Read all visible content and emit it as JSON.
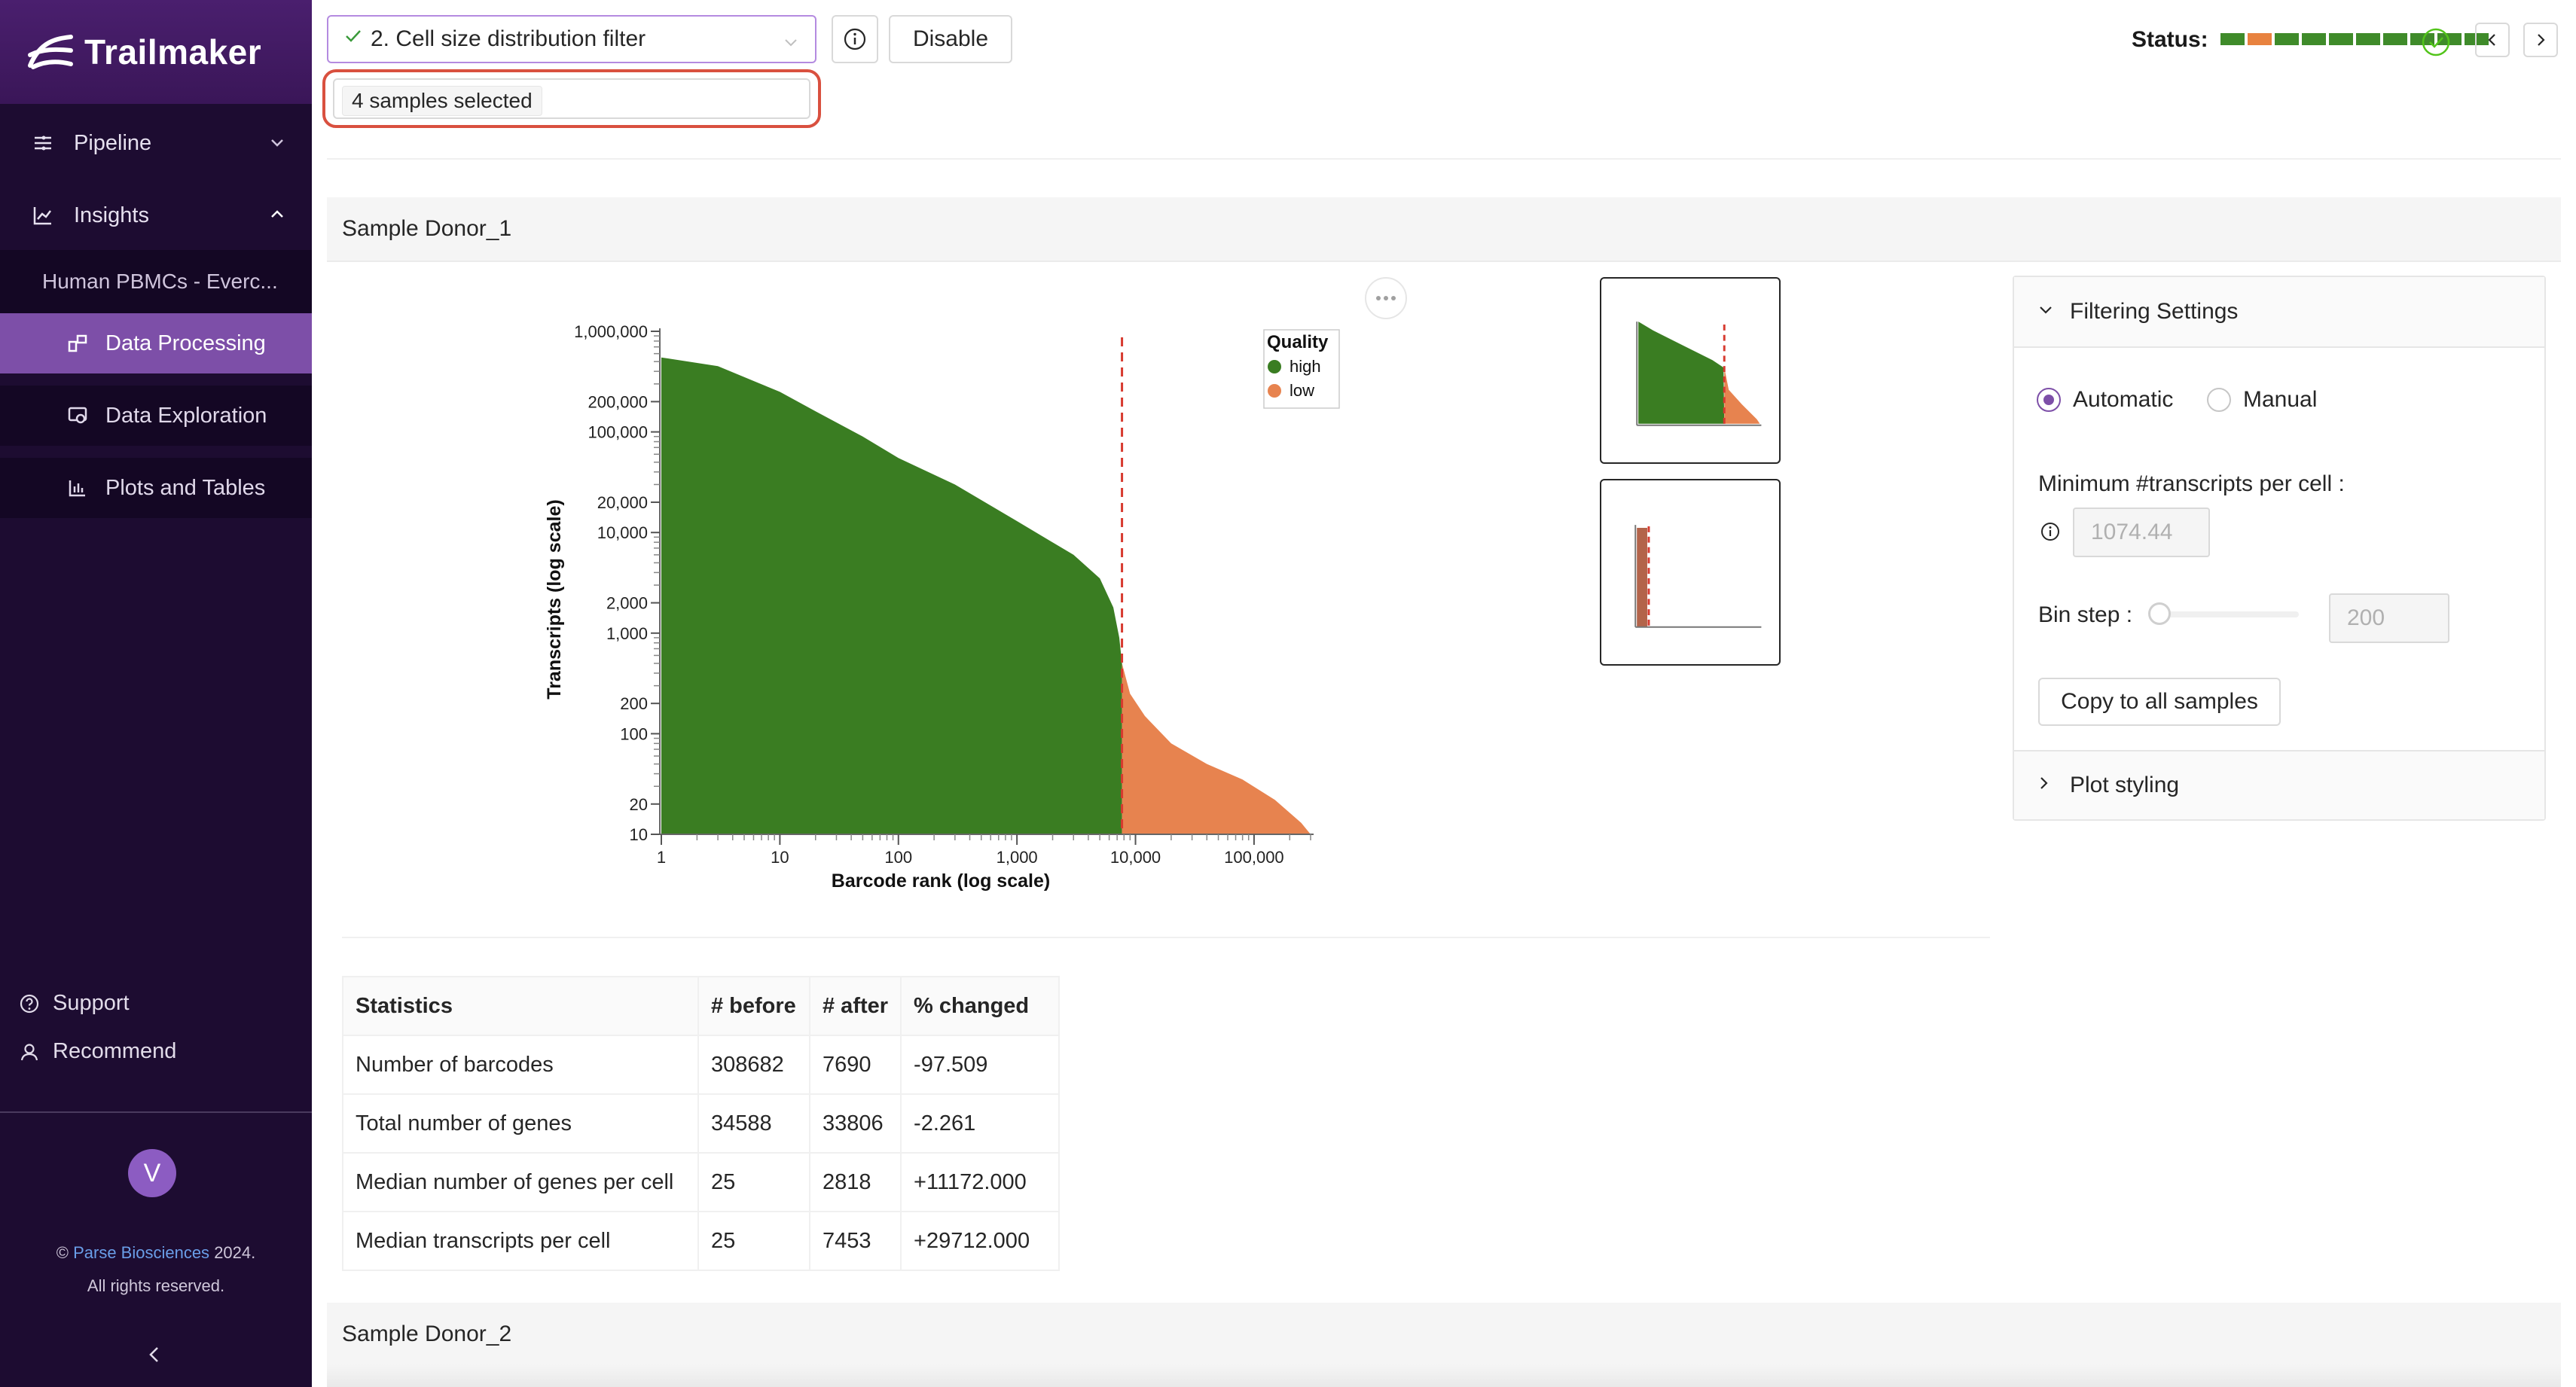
{
  "app": {
    "name": "Trailmaker"
  },
  "sidebar": {
    "pipeline": "Pipeline",
    "insights": "Insights",
    "project": "Human PBMCs - Everc...",
    "items": [
      {
        "label": "Data Processing"
      },
      {
        "label": "Data Exploration"
      },
      {
        "label": "Plots and Tables"
      }
    ],
    "support": "Support",
    "recommend": "Recommend",
    "avatar_initial": "V",
    "copyright_prefix": "©",
    "copyright_company": "Parse Biosciences",
    "copyright_year": "2024.",
    "copyright_rights": "All rights reserved."
  },
  "topbar": {
    "step": "2. Cell size distribution filter",
    "disable": "Disable",
    "samples_selected": "4 samples selected",
    "status_label": "Status:",
    "status_colors": [
      "#3f8b2a",
      "#e8823f",
      "#3f8b2a",
      "#3f8b2a",
      "#3f8b2a",
      "#3f8b2a",
      "#3f8b2a",
      "#3f8b2a",
      "#3f8b2a",
      "#3f8b2a"
    ]
  },
  "sample1": {
    "title": "Sample Donor_1"
  },
  "sample2": {
    "title": "Sample Donor_2"
  },
  "chart_data": {
    "type": "area",
    "xlabel": "Barcode rank (log scale)",
    "ylabel": "Transcripts (log scale)",
    "x_scale": "log",
    "y_scale": "log",
    "xlim": [
      1,
      300000
    ],
    "ylim": [
      10,
      1000000
    ],
    "x_ticks": [
      "1",
      "10",
      "100",
      "1,000",
      "10,000",
      "100,000"
    ],
    "x_tick_values": [
      1,
      10,
      100,
      1000,
      10000,
      100000
    ],
    "y_ticks": [
      "1,000,000",
      "200,000",
      "100,000",
      "20,000",
      "10,000",
      "2,000",
      "1,000",
      "200",
      "100",
      "20",
      "10"
    ],
    "y_tick_values": [
      1000000,
      200000,
      100000,
      20000,
      10000,
      2000,
      1000,
      200,
      100,
      20,
      10
    ],
    "threshold_x": 7690,
    "legend_title": "Quality",
    "legend_position": "top-right",
    "series": [
      {
        "name": "high",
        "color": "#3a7d22",
        "x": [
          1,
          3,
          10,
          20,
          50,
          100,
          300,
          1000,
          3000,
          5000,
          6500,
          7300,
          7690
        ],
        "y": [
          550000,
          450000,
          250000,
          160000,
          90000,
          55000,
          30000,
          13000,
          6000,
          3500,
          1800,
          900,
          500
        ]
      },
      {
        "name": "low",
        "color": "#e7834f",
        "x": [
          7690,
          9000,
          12000,
          20000,
          40000,
          80000,
          150000,
          250000,
          300000
        ],
        "y": [
          500,
          250,
          150,
          80,
          50,
          35,
          22,
          13,
          10
        ]
      }
    ]
  },
  "filtering": {
    "title": "Filtering Settings",
    "automatic": "Automatic",
    "manual": "Manual",
    "min_label": "Minimum #transcripts per cell :",
    "min_value": "1074.44",
    "bin_label": "Bin step :",
    "bin_value": "200",
    "copy": "Copy to all samples",
    "plot_styling": "Plot styling"
  },
  "stats": {
    "headers": [
      "Statistics",
      "# before",
      "# after",
      "% changed"
    ],
    "rows": [
      [
        "Number of barcodes",
        "308682",
        "7690",
        "-97.509"
      ],
      [
        "Total number of genes",
        "34588",
        "33806",
        "-2.261"
      ],
      [
        "Median number of genes per cell",
        "25",
        "2818",
        "+11172.000"
      ],
      [
        "Median transcripts per cell",
        "25",
        "7453",
        "+29712.000"
      ]
    ]
  }
}
